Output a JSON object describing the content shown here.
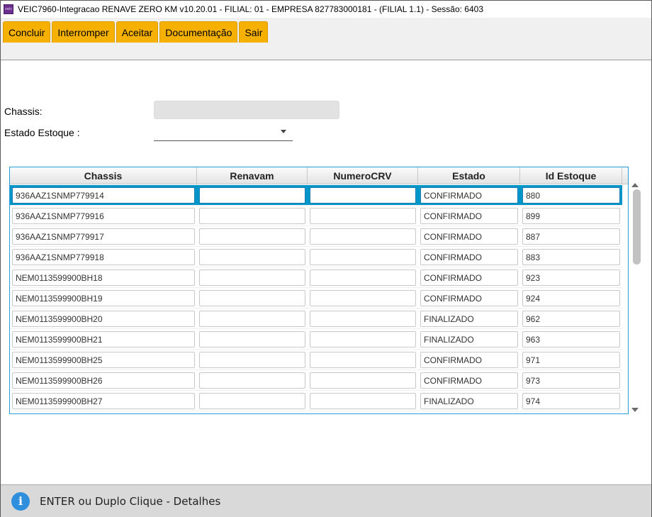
{
  "window": {
    "title": "VEIC7960-Integracao RENAVE ZERO KM v10.20.01   - FILIAL: 01 - EMPRESA 827783000181 - (FILIAL 1.1) - Sessão: 6403",
    "icon": "app-icon"
  },
  "toolbar": {
    "buttons": [
      {
        "id": "concluir",
        "label": "Concluir"
      },
      {
        "id": "interromper",
        "label": "Interromper"
      },
      {
        "id": "aceitar",
        "label": "Aceitar"
      },
      {
        "id": "documentacao",
        "label": "Documentação"
      },
      {
        "id": "sair",
        "label": "Sair"
      }
    ],
    "button_color": "#f5b000"
  },
  "form": {
    "chassis_label": "Chassis:",
    "chassis_value": "",
    "estado_label": "Estado Estoque :",
    "estado_value": ""
  },
  "grid": {
    "columns": [
      "Chassis",
      "Renavam",
      "NumeroCRV",
      "Estado",
      "Id Estoque"
    ],
    "selected_row_color": "#0096c9",
    "rows": [
      {
        "chassis": "936AAZ1SNMP779914",
        "renavam": "",
        "crv": "",
        "estado": "CONFIRMADO",
        "id": "880"
      },
      {
        "chassis": "936AAZ1SNMP779916",
        "renavam": "",
        "crv": "",
        "estado": "CONFIRMADO",
        "id": "899"
      },
      {
        "chassis": "936AAZ1SNMP779917",
        "renavam": "",
        "crv": "",
        "estado": "CONFIRMADO",
        "id": "887"
      },
      {
        "chassis": "936AAZ1SNMP779918",
        "renavam": "",
        "crv": "",
        "estado": "CONFIRMADO",
        "id": "883"
      },
      {
        "chassis": "NEM0113599900BH18",
        "renavam": "",
        "crv": "",
        "estado": "CONFIRMADO",
        "id": "923"
      },
      {
        "chassis": "NEM0113599900BH19",
        "renavam": "",
        "crv": "",
        "estado": "CONFIRMADO",
        "id": "924"
      },
      {
        "chassis": "NEM0113599900BH20",
        "renavam": "",
        "crv": "",
        "estado": "FINALIZADO",
        "id": "962"
      },
      {
        "chassis": "NEM0113599900BH21",
        "renavam": "",
        "crv": "",
        "estado": "FINALIZADO",
        "id": "963"
      },
      {
        "chassis": "NEM0113599900BH25",
        "renavam": "",
        "crv": "",
        "estado": "CONFIRMADO",
        "id": "971"
      },
      {
        "chassis": "NEM0113599900BH26",
        "renavam": "",
        "crv": "",
        "estado": "CONFIRMADO",
        "id": "973"
      },
      {
        "chassis": "NEM0113599900BH27",
        "renavam": "",
        "crv": "",
        "estado": "FINALIZADO",
        "id": "974"
      }
    ]
  },
  "status": {
    "icon": "info-icon",
    "text": "ENTER ou Duplo Clique - Detalhes"
  }
}
